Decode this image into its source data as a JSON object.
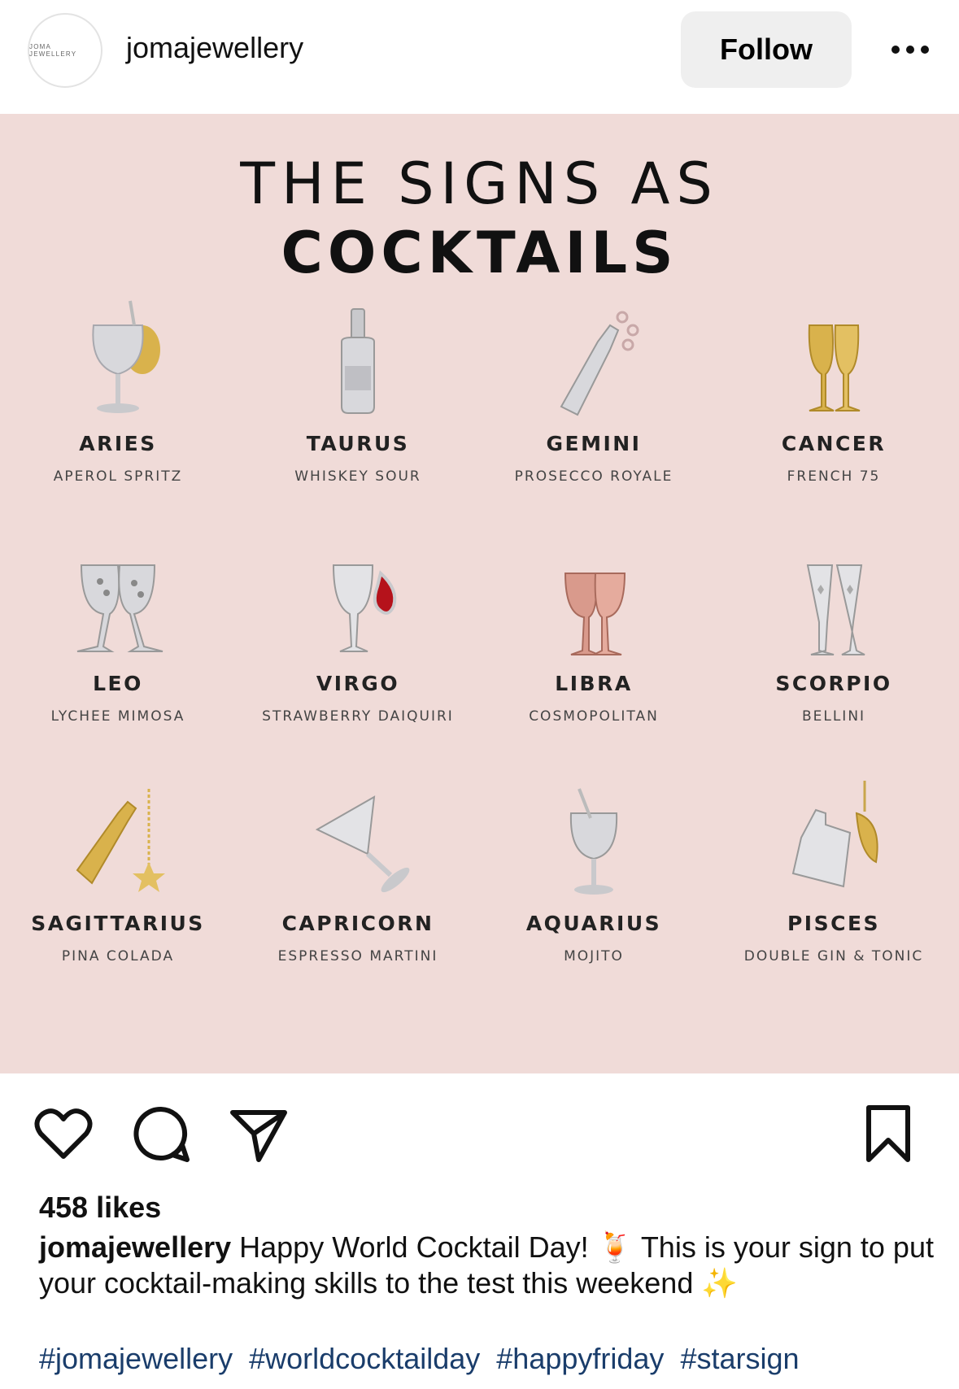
{
  "header": {
    "avatar_text": "JOMA JEWELLERY",
    "username": "jomajewellery",
    "follow_label": "Follow"
  },
  "post": {
    "title_line1": "THE SIGNS AS",
    "title_line2": "COCKTAILS",
    "signs": [
      {
        "sign": "ARIES",
        "drink": "APEROL SPRITZ",
        "icon": "wine-glass-charm-icon"
      },
      {
        "sign": "TAURUS",
        "drink": "WHISKEY SOUR",
        "icon": "bottle-charm-icon"
      },
      {
        "sign": "GEMINI",
        "drink": "PROSECCO ROYALE",
        "icon": "champagne-bottle-charm-icon"
      },
      {
        "sign": "CANCER",
        "drink": "FRENCH 75",
        "icon": "gold-flutes-charm-icon"
      },
      {
        "sign": "LEO",
        "drink": "LYCHEE MIMOSA",
        "icon": "crystal-glasses-charm-icon"
      },
      {
        "sign": "VIRGO",
        "drink": "STRAWBERRY DAIQUIRI",
        "icon": "glass-ruby-charm-icon"
      },
      {
        "sign": "LIBRA",
        "drink": "COSMOPOLITAN",
        "icon": "rose-gold-glasses-charm-icon"
      },
      {
        "sign": "SCORPIO",
        "drink": "BELLINI",
        "icon": "silver-flutes-charm-icon"
      },
      {
        "sign": "SAGITTARIUS",
        "drink": "PINA COLADA",
        "icon": "gold-bottle-star-charm-icon"
      },
      {
        "sign": "CAPRICORN",
        "drink": "ESPRESSO MARTINI",
        "icon": "martini-glass-charm-icon"
      },
      {
        "sign": "AQUARIUS",
        "drink": "MOJITO",
        "icon": "goblet-charm-icon"
      },
      {
        "sign": "PISCES",
        "drink": "DOUBLE GIN & TONIC",
        "icon": "gin-bottle-lemon-charm-icon"
      }
    ]
  },
  "actions": {
    "icons": [
      "heart-icon",
      "comment-icon",
      "share-icon",
      "bookmark-icon"
    ]
  },
  "likes_text": "458 likes",
  "caption": {
    "user": "jomajewellery",
    "text_part1": " Happy World Cocktail Day! ",
    "emoji1": "🍹",
    "text_part2": " This is your sign to put your cocktail-making skills to the test this weekend ",
    "emoji2": "✨"
  },
  "hashtags": [
    "#jomajewellery",
    "#worldcocktailday",
    "#happyfriday",
    "#starsign"
  ],
  "colors": {
    "post_background": "#f0dbd8",
    "follow_background": "#efefef",
    "hashtag": "#1a3d6b",
    "silver": "#c9c9cc",
    "gold": "#d9b24c",
    "rose_gold": "#d99a8c",
    "ruby": "#b5121b"
  }
}
